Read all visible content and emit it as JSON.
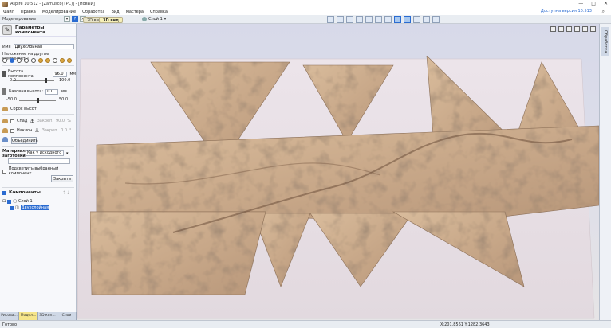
{
  "window": {
    "title": "Aspire 10.512 - [Zamusco(TPC)] - [Новый]",
    "controls": [
      "—",
      "□",
      "✕"
    ]
  },
  "menu": [
    "Файл",
    "Правка",
    "Моделирование",
    "Обработка",
    "Вид",
    "Мастера",
    "Справка"
  ],
  "upgrade_link": "Доступна версия 10.513",
  "toolbar": {
    "panel_title": "Моделирование",
    "view_2d": "2D вид",
    "view_3d": "3D вид",
    "layer": "Слой 1"
  },
  "component_panel": {
    "title": "Параметры компонента",
    "name_label": "Имя",
    "name_value": "Двухслойная",
    "combine_label": "Наложение на другие компоненты",
    "height_label": "Высота компонента:",
    "height_value": "96.0",
    "height_unit": "мм",
    "height_min": "0.0",
    "height_max": "100.0",
    "base_label": "Базовая высота:",
    "base_value": "0.0",
    "base_unit": "мм",
    "base_min": "-50.0",
    "base_max": "50.0",
    "reset_label": "Сброс высот",
    "fade_label": "Спад",
    "fade_lock": "Закреп.",
    "fade_value": "90.0",
    "fade_unit": "%",
    "tilt_label": "Наклон",
    "tilt_lock": "Закреп.",
    "tilt_value": "0.0",
    "tilt_unit": "°",
    "merge_button": "Объединить",
    "material_label": "Материал заготовки",
    "material_value": "Как у исходного",
    "show_selected_label": "Подсветить выбранный компонент",
    "close_button": "Закрыть"
  },
  "components": {
    "header": "Компоненты",
    "layer": "Слой 1",
    "item": "Двухслойная"
  },
  "bottom_tabs": [
    "Рисова...",
    "Модел...",
    "3D кол...",
    "Слои"
  ],
  "right_tab": "Обработка",
  "status": {
    "left": "Готово",
    "coords": "X:201.8561 Y:1282.3643"
  },
  "colors": {
    "relief": "#c9a98a",
    "accent": "#2a6bd1"
  }
}
